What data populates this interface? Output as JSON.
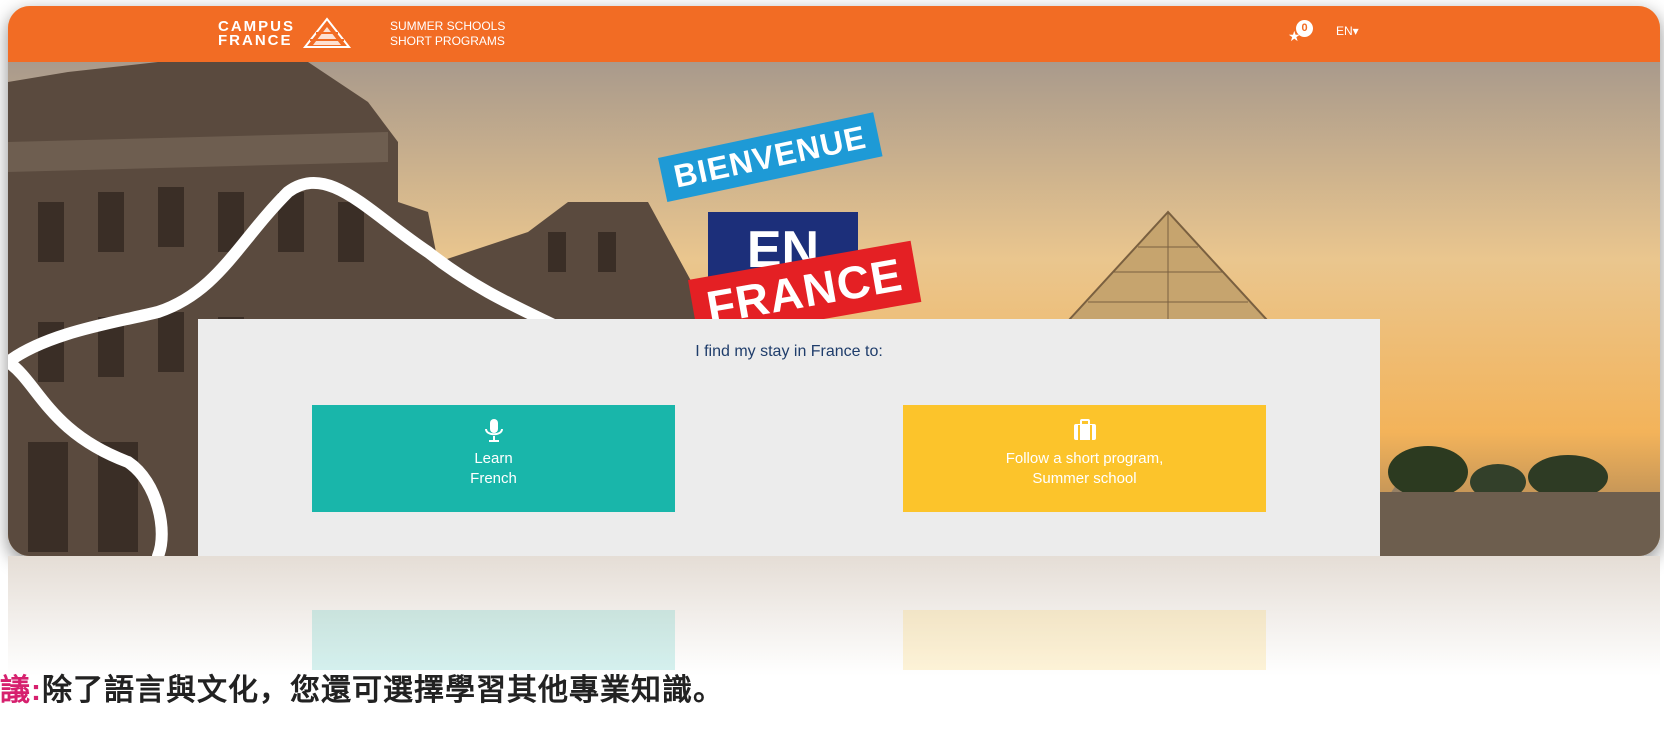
{
  "header": {
    "logo_line1": "CAMPUS",
    "logo_line2": "FRANCE",
    "tagline_line1": "SUMMER SCHOOLS",
    "tagline_line2": "SHORT PROGRAMS",
    "favorites_count": "0",
    "language": "EN▾"
  },
  "hero": {
    "stamp_line1": "BIENVENUE",
    "stamp_line2": "EN",
    "stamp_line3": "FRANCE"
  },
  "panel": {
    "title": "I find my stay in France to:",
    "options": [
      {
        "line1": "Learn",
        "line2": "French",
        "icon": "microphone-icon",
        "color": "#19b6aa"
      },
      {
        "line1": "Follow a short program,",
        "line2": "Summer school",
        "icon": "briefcase-icon",
        "color": "#fcc42b"
      }
    ]
  },
  "caption": {
    "prefix": "議:",
    "text": "除了語言與文化，您還可選擇學習其他專業知識。"
  },
  "colors": {
    "header": "#f26c24",
    "stamp_blue": "#1e9ad6",
    "stamp_navy": "#1c2f7a",
    "stamp_red": "#e42024",
    "panel": "#ececec",
    "panel_title": "#1f3d6b"
  }
}
